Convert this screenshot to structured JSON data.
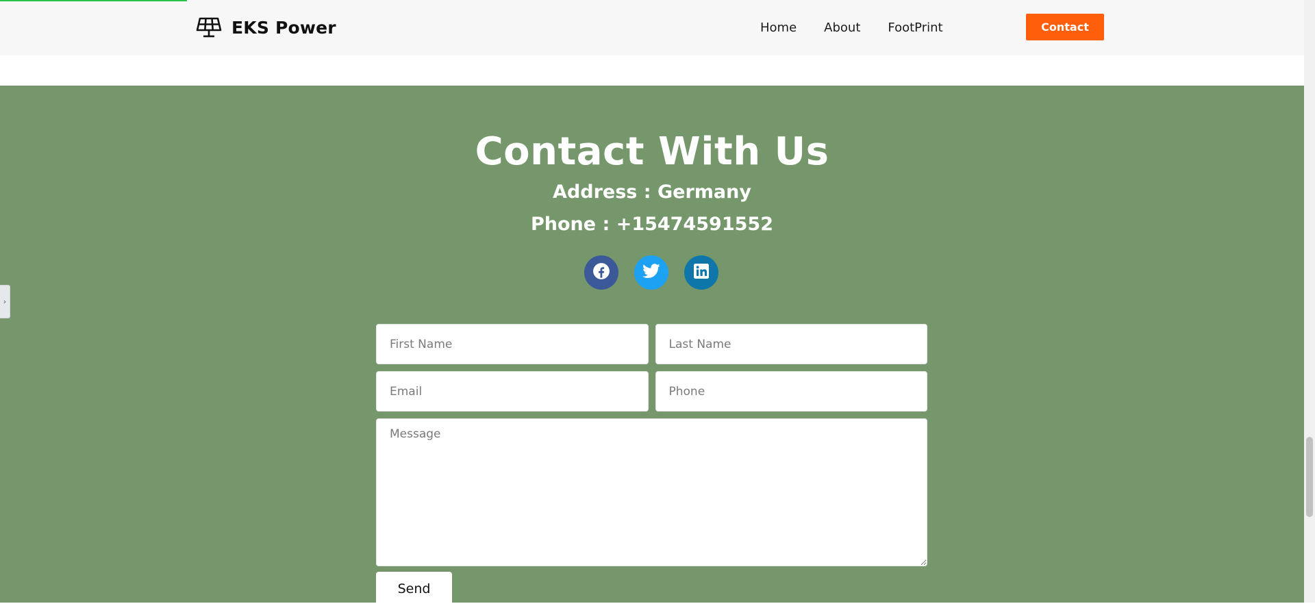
{
  "brand": {
    "name": "EKS Power",
    "icon": "solar-panel-icon"
  },
  "nav": {
    "links": [
      "Home",
      "About",
      "FootPrint"
    ],
    "contact_label": "Contact"
  },
  "contact": {
    "title": "Contact With Us",
    "address_label": "Address : ",
    "address_value": "Germany",
    "phone_label": "Phone : ",
    "phone_value": "+15474591552"
  },
  "socials": [
    {
      "name": "facebook",
      "icon": "facebook-icon",
      "color": "#3b5998"
    },
    {
      "name": "twitter",
      "icon": "twitter-icon",
      "color": "#1da1f2"
    },
    {
      "name": "linkedin",
      "icon": "linkedin-icon",
      "color": "#0e76a8"
    }
  ],
  "form": {
    "first_name_placeholder": "First Name",
    "last_name_placeholder": "Last Name",
    "email_placeholder": "Email",
    "phone_placeholder": "Phone",
    "message_placeholder": "Message",
    "send_label": "Send"
  },
  "colors": {
    "accent": "#ff5e0a",
    "section_bg": "#76976c",
    "navbar_bg": "#f7f7f7"
  },
  "side_tab": {
    "icon": "chevron-right-icon"
  }
}
